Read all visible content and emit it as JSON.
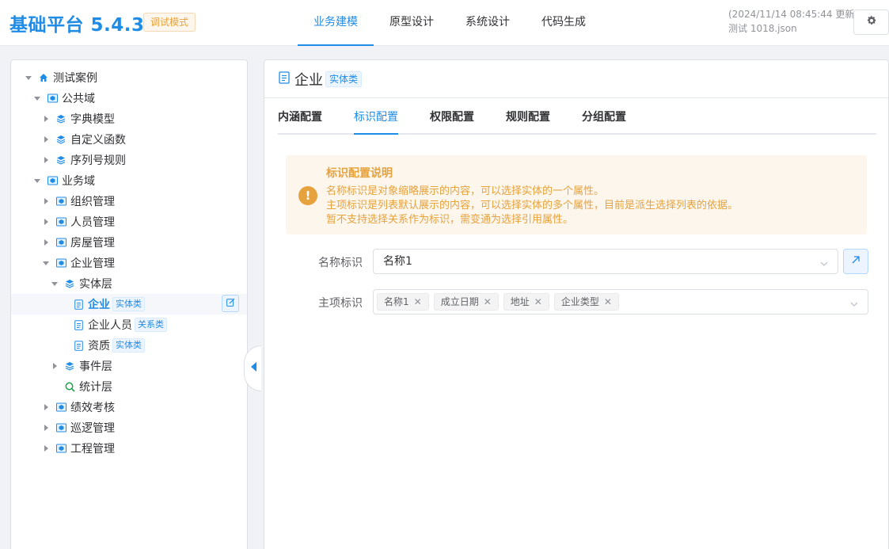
{
  "header": {
    "brand": "基础平台 5.4.3",
    "mode_badge": "调试模式",
    "nav": [
      {
        "label": "业务建模",
        "active": true
      },
      {
        "label": "原型设计",
        "active": false
      },
      {
        "label": "系统设计",
        "active": false
      },
      {
        "label": "代码生成",
        "active": false
      }
    ],
    "updated_time": "(2024/11/14 08:45:44 更新)",
    "file_name": "测试 1018.json",
    "settings_icon": "gear-icon"
  },
  "tree": [
    {
      "label": "测试案例",
      "level": 0,
      "expanded": true,
      "icon": "home-icon"
    },
    {
      "label": "公共域",
      "level": 1,
      "expanded": true,
      "icon": "domain-icon"
    },
    {
      "label": "字典模型",
      "level": 2,
      "expanded": false,
      "icon": "layers-icon"
    },
    {
      "label": "自定义函数",
      "level": 2,
      "expanded": false,
      "icon": "layers-icon"
    },
    {
      "label": "序列号规则",
      "level": 2,
      "expanded": false,
      "icon": "layers-icon"
    },
    {
      "label": "业务域",
      "level": 1,
      "expanded": true,
      "icon": "domain-icon"
    },
    {
      "label": "组织管理",
      "level": 2,
      "expanded": false,
      "icon": "domain-icon"
    },
    {
      "label": "人员管理",
      "level": 2,
      "expanded": false,
      "icon": "domain-icon"
    },
    {
      "label": "房屋管理",
      "level": 2,
      "expanded": false,
      "icon": "domain-icon"
    },
    {
      "label": "企业管理",
      "level": 2,
      "expanded": true,
      "icon": "domain-icon"
    },
    {
      "label": "实体层",
      "level": 3,
      "expanded": true,
      "icon": "layers-icon"
    },
    {
      "label": "企业",
      "level": 4,
      "leaf": true,
      "icon": "document-icon",
      "tag": "实体类",
      "selected": true
    },
    {
      "label": "企业人员",
      "level": 4,
      "leaf": true,
      "icon": "document-icon",
      "tag": "关系类"
    },
    {
      "label": "资质",
      "level": 4,
      "leaf": true,
      "icon": "document-icon",
      "tag": "实体类"
    },
    {
      "label": "事件层",
      "level": 3,
      "expanded": false,
      "icon": "layers-icon"
    },
    {
      "label": "统计层",
      "level": 3,
      "leaf": true,
      "icon": "search-icon"
    },
    {
      "label": "绩效考核",
      "level": 2,
      "expanded": false,
      "icon": "domain-icon"
    },
    {
      "label": "巡逻管理",
      "level": 2,
      "expanded": false,
      "icon": "domain-icon"
    },
    {
      "label": "工程管理",
      "level": 2,
      "expanded": false,
      "icon": "domain-icon"
    }
  ],
  "entity": {
    "title": "企业",
    "tag": "实体类",
    "tabs": [
      {
        "label": "内涵配置",
        "active": false
      },
      {
        "label": "标识配置",
        "active": true
      },
      {
        "label": "权限配置",
        "active": false
      },
      {
        "label": "规则配置",
        "active": false
      },
      {
        "label": "分组配置",
        "active": false
      }
    ]
  },
  "notice": {
    "title": "标识配置说明",
    "lines": [
      "名称标识是对象缩略展示的内容，可以选择实体的一个属性。",
      "主项标识是列表默认展示的内容，可以选择实体的多个属性，目前是派生选择列表的依据。",
      "暂不支持选择关系作为标识，需变通为选择引用属性。"
    ]
  },
  "form": {
    "name_id_label": "名称标识",
    "name_id_value": "名称1",
    "main_id_label": "主项标识",
    "main_id_values": [
      "名称1",
      "成立日期",
      "地址",
      "企业类型"
    ]
  },
  "colors": {
    "primary": "#1f8ce6",
    "warning": "#e6a23c",
    "tree_icon": "#1f8ce6",
    "stat_icon": "#1aa34a"
  }
}
